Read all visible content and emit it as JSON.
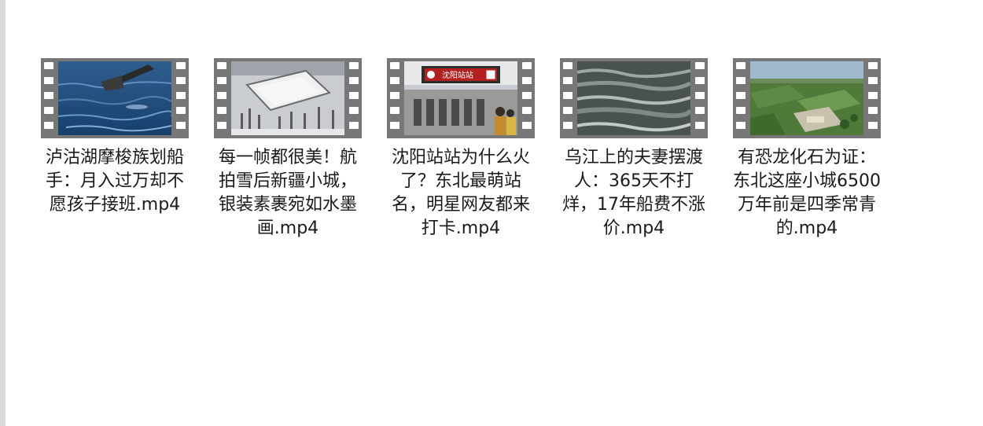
{
  "files": [
    {
      "name": "泸沽湖摩梭族划船手：月入过万却不愿孩子接班.mp4",
      "thumbnail": "lake-rowing-oar"
    },
    {
      "name": "每一帧都很美！航拍雪后新疆小城，银装素裹宛如水墨画.mp4",
      "thumbnail": "snowy-town-aerial"
    },
    {
      "name": "沈阳站站为什么火了？东北最萌站名，明星网友都来打卡.mp4",
      "thumbnail": "shenyang-station-sign"
    },
    {
      "name": "乌江上的夫妻摆渡人：365天不打烊，17年船费不涨价.mp4",
      "thumbnail": "river-water-surface"
    },
    {
      "name": "有恐龙化石为证：东北这座小城6500万年前是四季常青的.mp4",
      "thumbnail": "green-park-aerial"
    }
  ],
  "station_sign": "沈阳站站"
}
